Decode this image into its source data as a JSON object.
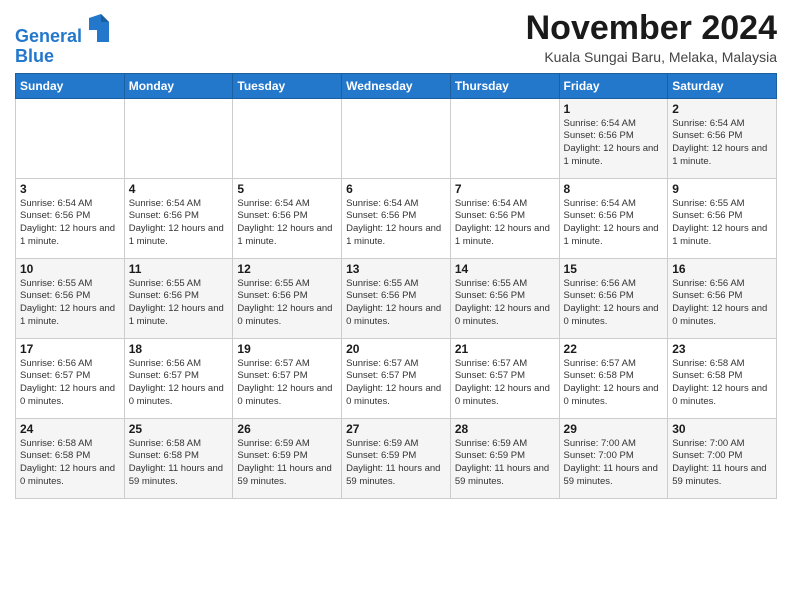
{
  "header": {
    "logo_line1": "General",
    "logo_line2": "Blue",
    "month_title": "November 2024",
    "location": "Kuala Sungai Baru, Melaka, Malaysia"
  },
  "days_of_week": [
    "Sunday",
    "Monday",
    "Tuesday",
    "Wednesday",
    "Thursday",
    "Friday",
    "Saturday"
  ],
  "weeks": [
    [
      {
        "num": "",
        "info": ""
      },
      {
        "num": "",
        "info": ""
      },
      {
        "num": "",
        "info": ""
      },
      {
        "num": "",
        "info": ""
      },
      {
        "num": "",
        "info": ""
      },
      {
        "num": "1",
        "info": "Sunrise: 6:54 AM\nSunset: 6:56 PM\nDaylight: 12 hours and 1 minute."
      },
      {
        "num": "2",
        "info": "Sunrise: 6:54 AM\nSunset: 6:56 PM\nDaylight: 12 hours and 1 minute."
      }
    ],
    [
      {
        "num": "3",
        "info": "Sunrise: 6:54 AM\nSunset: 6:56 PM\nDaylight: 12 hours and 1 minute."
      },
      {
        "num": "4",
        "info": "Sunrise: 6:54 AM\nSunset: 6:56 PM\nDaylight: 12 hours and 1 minute."
      },
      {
        "num": "5",
        "info": "Sunrise: 6:54 AM\nSunset: 6:56 PM\nDaylight: 12 hours and 1 minute."
      },
      {
        "num": "6",
        "info": "Sunrise: 6:54 AM\nSunset: 6:56 PM\nDaylight: 12 hours and 1 minute."
      },
      {
        "num": "7",
        "info": "Sunrise: 6:54 AM\nSunset: 6:56 PM\nDaylight: 12 hours and 1 minute."
      },
      {
        "num": "8",
        "info": "Sunrise: 6:54 AM\nSunset: 6:56 PM\nDaylight: 12 hours and 1 minute."
      },
      {
        "num": "9",
        "info": "Sunrise: 6:55 AM\nSunset: 6:56 PM\nDaylight: 12 hours and 1 minute."
      }
    ],
    [
      {
        "num": "10",
        "info": "Sunrise: 6:55 AM\nSunset: 6:56 PM\nDaylight: 12 hours and 1 minute."
      },
      {
        "num": "11",
        "info": "Sunrise: 6:55 AM\nSunset: 6:56 PM\nDaylight: 12 hours and 1 minute."
      },
      {
        "num": "12",
        "info": "Sunrise: 6:55 AM\nSunset: 6:56 PM\nDaylight: 12 hours and 0 minutes."
      },
      {
        "num": "13",
        "info": "Sunrise: 6:55 AM\nSunset: 6:56 PM\nDaylight: 12 hours and 0 minutes."
      },
      {
        "num": "14",
        "info": "Sunrise: 6:55 AM\nSunset: 6:56 PM\nDaylight: 12 hours and 0 minutes."
      },
      {
        "num": "15",
        "info": "Sunrise: 6:56 AM\nSunset: 6:56 PM\nDaylight: 12 hours and 0 minutes."
      },
      {
        "num": "16",
        "info": "Sunrise: 6:56 AM\nSunset: 6:56 PM\nDaylight: 12 hours and 0 minutes."
      }
    ],
    [
      {
        "num": "17",
        "info": "Sunrise: 6:56 AM\nSunset: 6:57 PM\nDaylight: 12 hours and 0 minutes."
      },
      {
        "num": "18",
        "info": "Sunrise: 6:56 AM\nSunset: 6:57 PM\nDaylight: 12 hours and 0 minutes."
      },
      {
        "num": "19",
        "info": "Sunrise: 6:57 AM\nSunset: 6:57 PM\nDaylight: 12 hours and 0 minutes."
      },
      {
        "num": "20",
        "info": "Sunrise: 6:57 AM\nSunset: 6:57 PM\nDaylight: 12 hours and 0 minutes."
      },
      {
        "num": "21",
        "info": "Sunrise: 6:57 AM\nSunset: 6:57 PM\nDaylight: 12 hours and 0 minutes."
      },
      {
        "num": "22",
        "info": "Sunrise: 6:57 AM\nSunset: 6:58 PM\nDaylight: 12 hours and 0 minutes."
      },
      {
        "num": "23",
        "info": "Sunrise: 6:58 AM\nSunset: 6:58 PM\nDaylight: 12 hours and 0 minutes."
      }
    ],
    [
      {
        "num": "24",
        "info": "Sunrise: 6:58 AM\nSunset: 6:58 PM\nDaylight: 12 hours and 0 minutes."
      },
      {
        "num": "25",
        "info": "Sunrise: 6:58 AM\nSunset: 6:58 PM\nDaylight: 11 hours and 59 minutes."
      },
      {
        "num": "26",
        "info": "Sunrise: 6:59 AM\nSunset: 6:59 PM\nDaylight: 11 hours and 59 minutes."
      },
      {
        "num": "27",
        "info": "Sunrise: 6:59 AM\nSunset: 6:59 PM\nDaylight: 11 hours and 59 minutes."
      },
      {
        "num": "28",
        "info": "Sunrise: 6:59 AM\nSunset: 6:59 PM\nDaylight: 11 hours and 59 minutes."
      },
      {
        "num": "29",
        "info": "Sunrise: 7:00 AM\nSunset: 7:00 PM\nDaylight: 11 hours and 59 minutes."
      },
      {
        "num": "30",
        "info": "Sunrise: 7:00 AM\nSunset: 7:00 PM\nDaylight: 11 hours and 59 minutes."
      }
    ]
  ]
}
